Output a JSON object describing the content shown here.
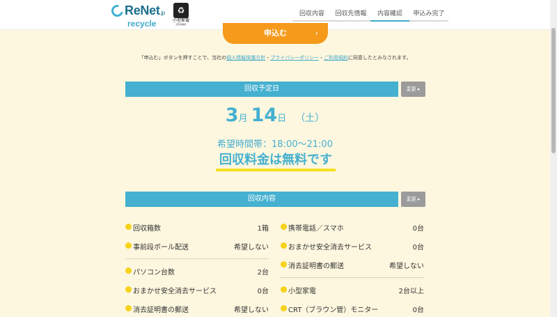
{
  "header": {
    "logo": {
      "name": "ReNet",
      "suffix": ".jp",
      "sub": "recycle"
    },
    "cert": {
      "text": "小型家電",
      "sub": "認定事業者"
    },
    "steps": [
      {
        "label": "回収内容",
        "active": false
      },
      {
        "label": "回収先情報",
        "active": false
      },
      {
        "label": "内容確認",
        "active": true
      },
      {
        "label": "申込み完了",
        "active": false
      }
    ]
  },
  "apply": {
    "label": "申込む",
    "chevron": "›"
  },
  "agree": {
    "pre": "「申込む」ボタンを押すことで、当社の",
    "link1": "個人情報保護方針",
    "sep1": "・",
    "link2": "プライバシーポリシー",
    "sep2": "・",
    "link3": "ご利用規約",
    "post": "に同意したとみなされます。"
  },
  "schedule": {
    "title": "回収予定日",
    "change_label": "変更",
    "month": "3",
    "month_unit": "月",
    "day": "14",
    "day_unit": "日",
    "weekday": "（土）",
    "time_label": "希望時間帯：",
    "time": "18:00〜21:00",
    "fee": "回収料金は無料です"
  },
  "contents": {
    "title": "回収内容",
    "change_label": "変更",
    "left": [
      {
        "label": "回収箱数",
        "value": "1箱"
      },
      {
        "label": "事前段ボール配送",
        "value": "希望しない"
      },
      {
        "label": "パソコン台数",
        "value": "2台"
      },
      {
        "label": "おまかせ安全消去サービス",
        "value": "0台"
      },
      {
        "label": "消去証明書の郵送",
        "value": "希望しない"
      }
    ],
    "right": [
      {
        "label": "携帯電話／スマホ",
        "value": "0台"
      },
      {
        "label": "おまかせ安全消去サービス",
        "value": "0台"
      },
      {
        "label": "消去証明書の郵送",
        "value": "希望しない"
      },
      {
        "label": "小型家電",
        "value": "2台以上"
      },
      {
        "label": "CRT（ブラウン管）モニター",
        "value": "0台"
      }
    ]
  },
  "colors": {
    "accent": "#45b0d0",
    "button": "#f59a1b",
    "bullet": "#f6d21a",
    "background": "#fdf7df"
  }
}
